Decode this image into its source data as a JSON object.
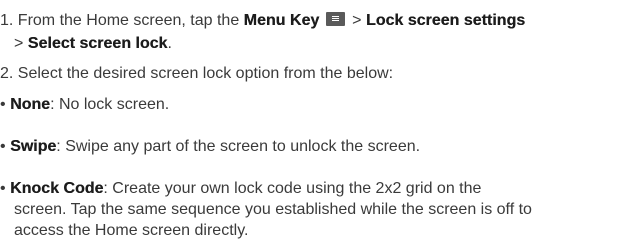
{
  "step1": {
    "number": "1.",
    "intro": "From the Home screen, tap the ",
    "menu_key": "Menu Key",
    "sep1": " > ",
    "lock_screen_settings": "Lock screen settings",
    "sep2": "> ",
    "select_screen_lock": "Select screen lock",
    "end": "."
  },
  "step2": {
    "text": "2. Select the desired screen lock option from the below:"
  },
  "options": [
    {
      "bullet": "•",
      "name": "None",
      "desc": ": No lock screen."
    },
    {
      "bullet": "•",
      "name": "Swipe",
      "desc": ": Swipe any part of the screen to unlock the screen."
    },
    {
      "bullet": "•",
      "name": "Knock Code",
      "desc_line1": ": Create your own lock code using the 2x2 grid on the",
      "desc_line2": "screen. Tap the same sequence you established while the screen is off to",
      "desc_line3": "access the Home screen directly."
    }
  ],
  "icons": {
    "menu_key_icon": "menu-key-icon",
    "menu_key_color": "#5a5a5a"
  }
}
